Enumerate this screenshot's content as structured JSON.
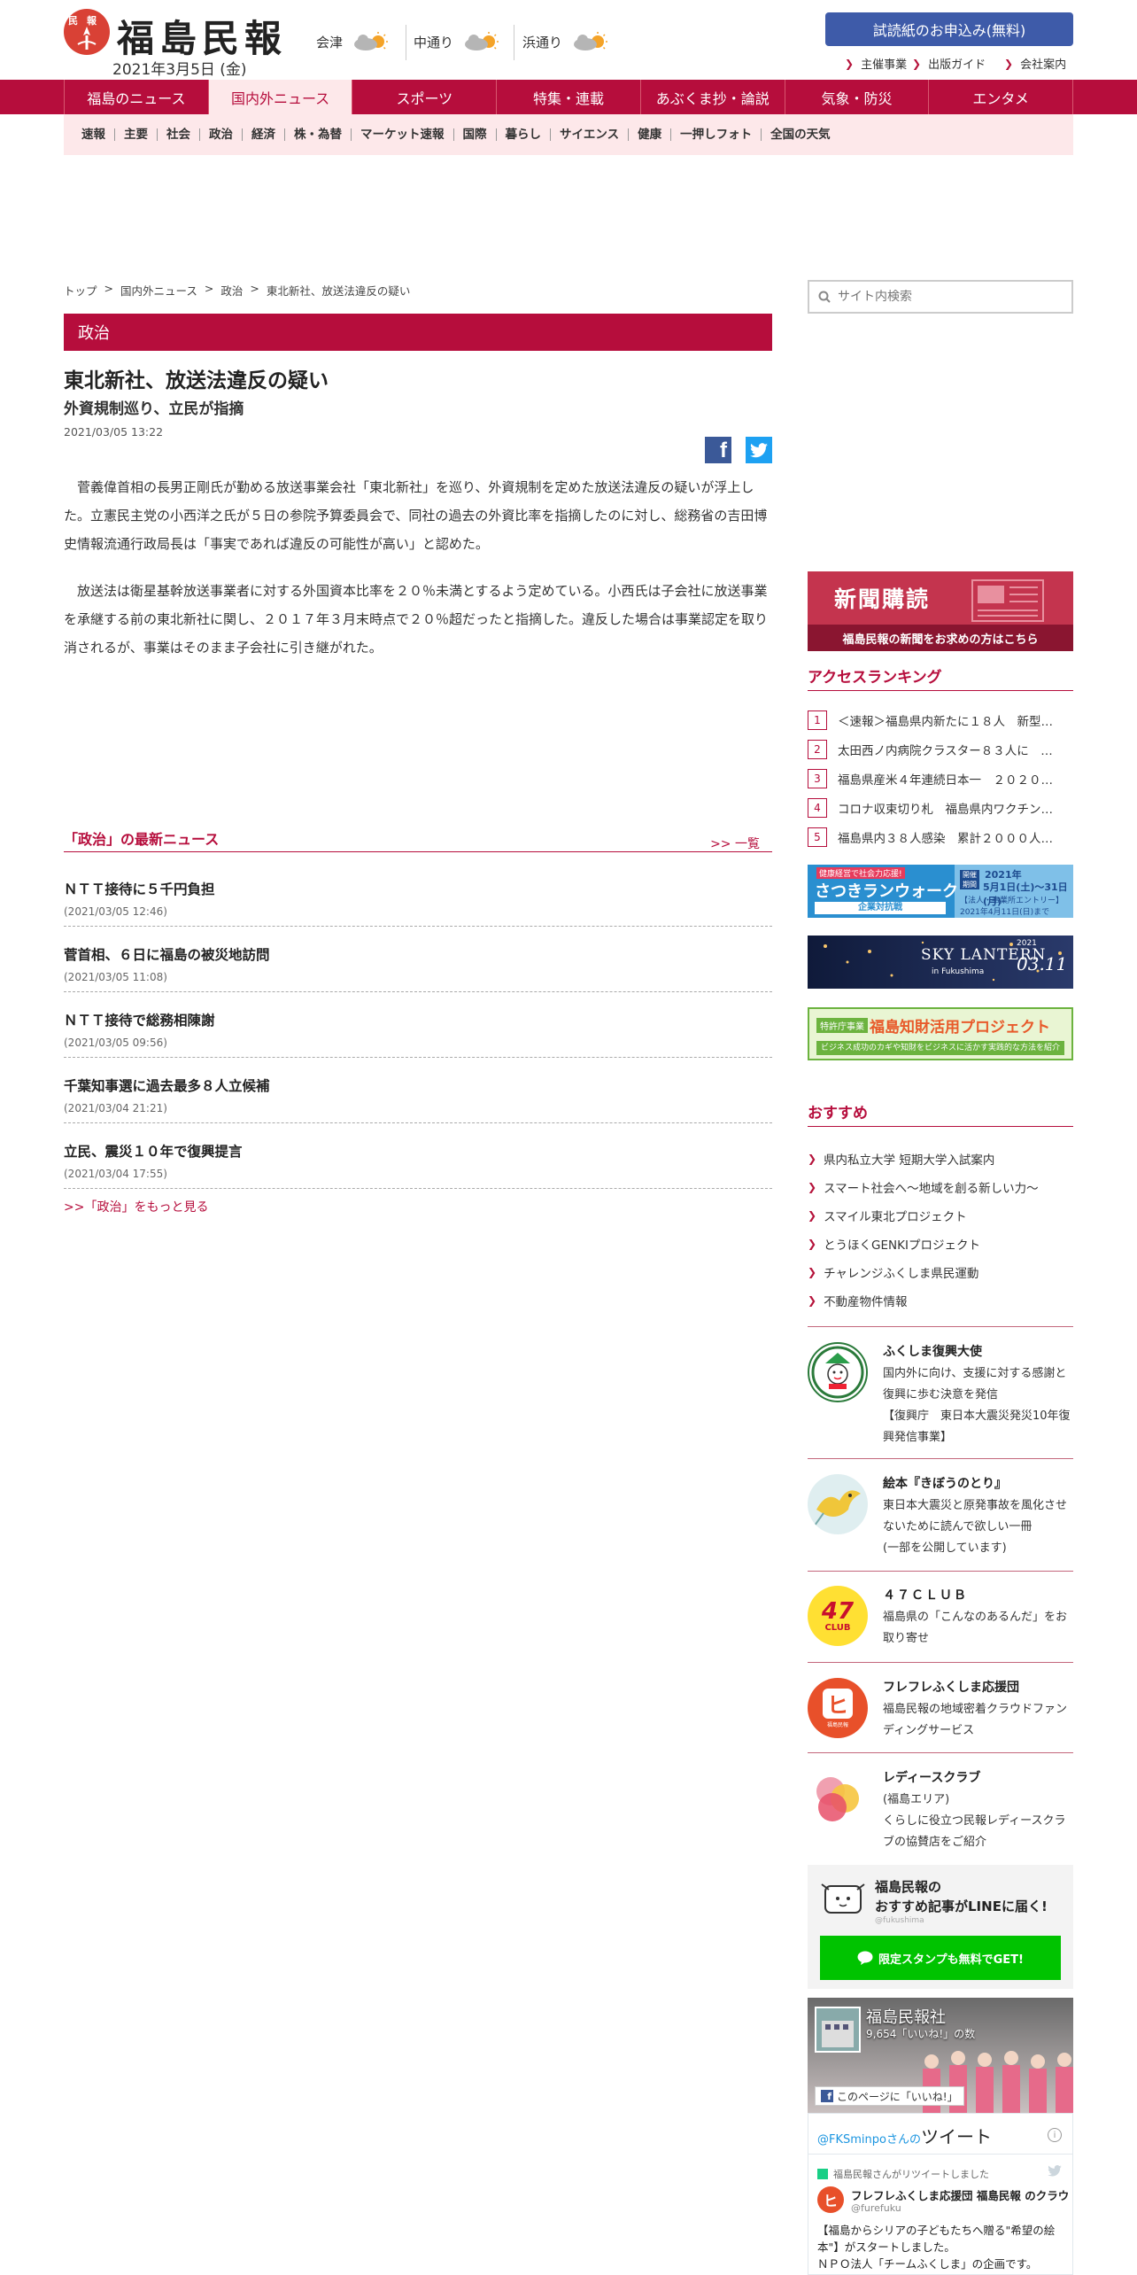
{
  "header": {
    "logo_badge": "民報",
    "logo_text": "福島民報",
    "date": "2021年3月5日 (金)",
    "weather": [
      {
        "region": "会津",
        "icon": "cloud-sun-icon"
      },
      {
        "region": "中通り",
        "icon": "cloud-sun-icon"
      },
      {
        "region": "浜通り",
        "icon": "cloud-sun-icon"
      }
    ],
    "trial_button": "試読紙のお申込み(無料)",
    "links": [
      "主催事業",
      "出版ガイド",
      "会社案内"
    ]
  },
  "nav": [
    "福島のニュース",
    "国内外ニュース",
    "スポーツ",
    "特集・連載",
    "あぶくま抄・論説",
    "気象・防災",
    "エンタメ"
  ],
  "subnav": [
    "速報",
    "主要",
    "社会",
    "政治",
    "経済",
    "株・為替",
    "マーケット速報",
    "国際",
    "暮らし",
    "サイエンス",
    "健康",
    "一押しフォト",
    "全国の天気"
  ],
  "breadcrumb": [
    "トップ",
    "国内外ニュース",
    "政治",
    "東北新社、放送法違反の疑い"
  ],
  "article": {
    "category": "政治",
    "title": "東北新社、放送法違反の疑い",
    "subtitle": "外資規制巡り、立民が指摘",
    "datetime": "2021/03/05 13:22",
    "paragraphs": [
      "菅義偉首相の長男正剛氏が勤める放送事業会社「東北新社」を巡り、外資規制を定めた放送法違反の疑いが浮上した。立憲民主党の小西洋之氏が５日の参院予算委員会で、同社の過去の外資比率を指摘したのに対し、総務省の吉田博史情報流通行政局長は「事実であれば違反の可能性が高い」と認めた。",
      "放送法は衛星基幹放送事業者に対する外国資本比率を２０％未満とするよう定めている。小西氏は子会社に放送事業を承継する前の東北新社に関し、２０１７年３月末時点で２０％超だったと指摘した。違反した場合は事業認定を取り消されるが、事業はそのまま子会社に引き継がれた。"
    ]
  },
  "latest": {
    "title": "「政治」の最新ニュース",
    "more": ">> 一覧",
    "items": [
      {
        "title": "ＮＴＴ接待に５千円負担",
        "date": "(2021/03/05 12:46)"
      },
      {
        "title": "菅首相、６日に福島の被災地訪問",
        "date": "(2021/03/05 11:08)"
      },
      {
        "title": "ＮＴＴ接待で総務相陳謝",
        "date": "(2021/03/05 09:56)"
      },
      {
        "title": "千葉知事選に過去最多８人立候補",
        "date": "(2021/03/04 21:21)"
      },
      {
        "title": "立民、震災１０年で復興提言",
        "date": "(2021/03/04 17:55)"
      }
    ],
    "see_more": ">>「政治」をもっと見る"
  },
  "sidebar": {
    "search_placeholder": "サイト内検索",
    "subscribe": {
      "title": "新聞購読",
      "band": "福島民報の新聞をお求めの方はこちら"
    },
    "ranking_title": "アクセスランキング",
    "ranking": [
      {
        "n": "1",
        "text": "＜速報＞福島県内新たに１８人　新型…"
      },
      {
        "n": "2",
        "text": "太田西ノ内病院クラスター８３人に　…"
      },
      {
        "n": "3",
        "text": "福島県産米４年連続日本一　２０２０…"
      },
      {
        "n": "4",
        "text": "コロナ収束切り札　福島県内ワクチン…"
      },
      {
        "n": "5",
        "text": "福島県内３８人感染　累計２０００人…"
      }
    ],
    "banners": {
      "walk_top": "健康経営で社会力応援!",
      "walk": "さつきランウォーク",
      "walk_sub": "企業対抗戦",
      "walk_badge": "開催期間",
      "walk_year": "2021年",
      "walk_dates": "5月1日(土)〜31日(月)",
      "walk_entry": "【法人・事業所エントリー】",
      "walk_deadline": "2021年4月11日(日)まで",
      "lantern": "SKY LANTERN",
      "lantern_place": "in Fukushima",
      "lantern_year": "2021",
      "lantern_date": "03.11",
      "ip_tag": "特許庁事業",
      "ip": "福島知財活用プロジェクト",
      "ip_sub": "ビジネス成功のカギや知財をビジネスに活かす実践的な方法を紹介"
    },
    "recommend_title": "おすすめ",
    "recommend": [
      "県内私立大学 短期大学入試案内",
      "スマート社会へ〜地域を創る新しい力〜",
      "スマイル東北プロジェクト",
      "とうほくGENKIプロジェクト",
      "チャレンジふくしま県民運動",
      "不動産物件情報"
    ],
    "promos": [
      {
        "title": "ふくしま復興大使",
        "desc": "国内外に向け、支援に対する感謝と復興に歩む決意を発信\n【復興庁　東日本大震災発災10年復興発信事業】",
        "icon": "ambassador-icon"
      },
      {
        "title": "絵本『きぼうのとり』",
        "desc": "東日本大震災と原発事故を風化させないために読んで欲しい一冊\n(一部を公開しています)",
        "icon": "bird-icon"
      },
      {
        "title": "４７ＣＬＵＢ",
        "desc": "福島県の「こんなのあるんだ」をお取り寄せ",
        "icon": "47club-icon",
        "badge_num": "47",
        "badge_label": "CLUB"
      },
      {
        "title": "フレフレふくしま応援団",
        "desc": "福島民報の地域密着クラウドファンディングサービス",
        "icon": "cheer-icon",
        "badge_label": "福島民報"
      },
      {
        "title": "レディースクラブ",
        "desc": "(福島エリア)\nくらしに役立つ民報レディースクラブの協賛店をご紹介",
        "icon": "ladies-icon"
      }
    ],
    "line": {
      "title": "福島民報の\nおすすめ記事がLINEに届く!",
      "handle": "@fukushima",
      "button": "限定スタンプも無料でGET!"
    },
    "facebook": {
      "page": "福島民報社",
      "likes": "9,654「いいね!」の数",
      "like_button": "このページに「いいね!」"
    },
    "twitter": {
      "header_pre": "@FKSminpoさんの",
      "header": "ツイート",
      "retweet": "福島民報さんがリツイートしました",
      "user": "フレフレふくしま応援団 福島民報 のクラウ",
      "handle": "@furefuku",
      "text": "【福島からシリアの子どもたちへ贈る\"希望の絵本\"】がスタートしました。\nＮＰＯ法人「チームふくしま」の企画です。"
    }
  }
}
